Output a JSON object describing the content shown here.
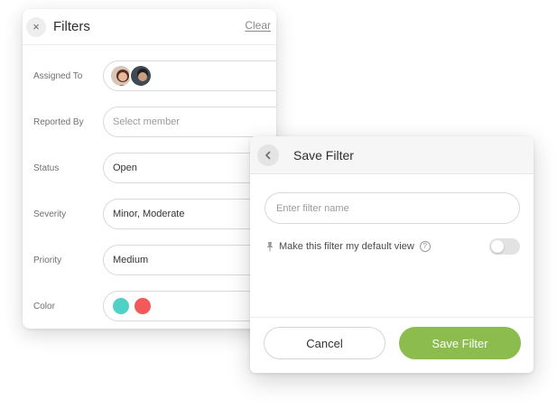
{
  "filters": {
    "title": "Filters",
    "clear_label": "Clear",
    "close_icon": "×",
    "rows": {
      "assigned_to": {
        "label": "Assigned To"
      },
      "reported_by": {
        "label": "Reported By",
        "placeholder": "Select member"
      },
      "status": {
        "label": "Status",
        "value": "Open"
      },
      "severity": {
        "label": "Severity",
        "value": "Minor, Moderate"
      },
      "priority": {
        "label": "Priority",
        "value": "Medium"
      },
      "color": {
        "label": "Color",
        "swatches": [
          "#4fd1c5",
          "#f25a5a"
        ]
      }
    }
  },
  "save_dialog": {
    "title": "Save Filter",
    "name_placeholder": "Enter filter name",
    "default_label": "Make this filter my default view",
    "help_glyph": "?",
    "default_enabled": false,
    "cancel_label": "Cancel",
    "save_label": "Save Filter"
  },
  "colors": {
    "accent_green": "#8cbc4d",
    "border": "#d9d9d9"
  },
  "icons": [
    "close-icon",
    "chevron-down-icon",
    "back-arrow-icon",
    "pin-icon",
    "help-icon"
  ]
}
